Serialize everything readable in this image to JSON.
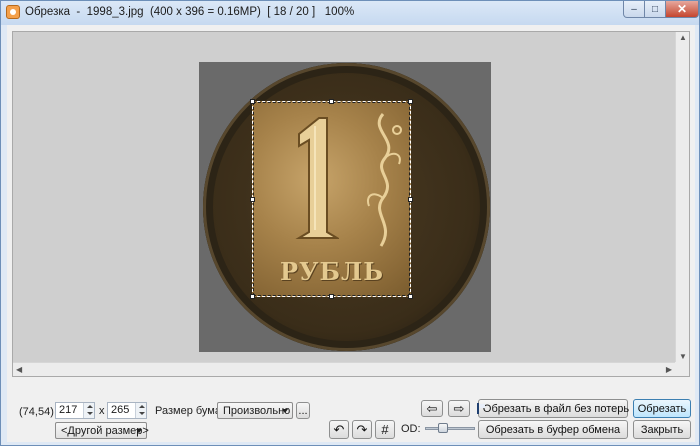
{
  "window": {
    "title": "Обрезка  -  1998_3.jpg  (400 x 396 = 0.16MP)  [ 18 / 20 ]   100%",
    "min_label": "–",
    "max_label": "□",
    "close_label": "✕"
  },
  "image": {
    "caption_on_coin": "РУБЛЬ",
    "numeral": "1"
  },
  "bottom": {
    "coords": "(74,54)",
    "width_value": "217",
    "height_value": "265",
    "times_sign": "x",
    "paper_size_label": "Размер бумаги:",
    "paper_size_value": "Произвольно",
    "more_button": "...",
    "other_size_value": "<Другой размер>",
    "arrow_left": "⇦",
    "arrow_right": "⇨",
    "rotate_left": "↶",
    "rotate_right": "↷",
    "grid_button": "#",
    "od_label": "OD:",
    "od_level": 0.3,
    "crop_lossless_button": "Обрезать в файл без потерь",
    "crop_clipboard_button": "Обрезать в буфер обмена",
    "crop_button": "Обрезать",
    "close_button": "Закрыть"
  }
}
